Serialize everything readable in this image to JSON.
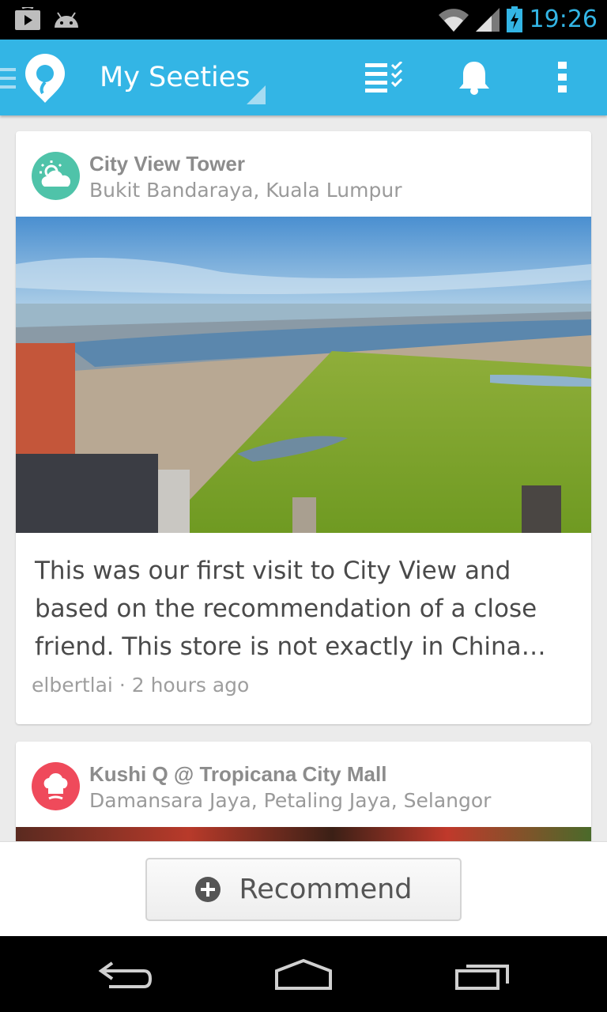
{
  "status_bar": {
    "time": "19:26",
    "icons": [
      "play-store-icon",
      "android-icon",
      "wifi-icon",
      "signal-icon",
      "battery-charging-icon"
    ]
  },
  "action_bar": {
    "title": "My Seeties",
    "icons": [
      "menu-icon",
      "seeties-logo-icon",
      "checklist-icon",
      "notification-bell-icon",
      "overflow-menu-icon"
    ],
    "color": "#33b5e5"
  },
  "feed": {
    "posts": [
      {
        "place_name": "City View Tower",
        "address": "Bukit Bandaraya, Kuala Lumpur",
        "category_icon": "weather-cloud-sun-icon",
        "icon_color": "#4fc3a9",
        "review": "This was our first visit to City View and based on the recommendation of a close friend. This store is not exactly in China…",
        "author": "elbertlai",
        "separator": "·",
        "time_ago": "2 hours ago"
      },
      {
        "place_name": "Kushi Q @ Tropicana City Mall",
        "address": "Damansara Jaya, Petaling Jaya, Selangor",
        "category_icon": "chef-hat-icon",
        "icon_color": "#ef4a5b"
      }
    ]
  },
  "bottom_bar": {
    "recommend_label": "Recommend",
    "recommend_icon": "plus-circle-icon"
  },
  "nav_bar": {
    "icons": [
      "back-icon",
      "home-icon",
      "recent-apps-icon"
    ]
  }
}
